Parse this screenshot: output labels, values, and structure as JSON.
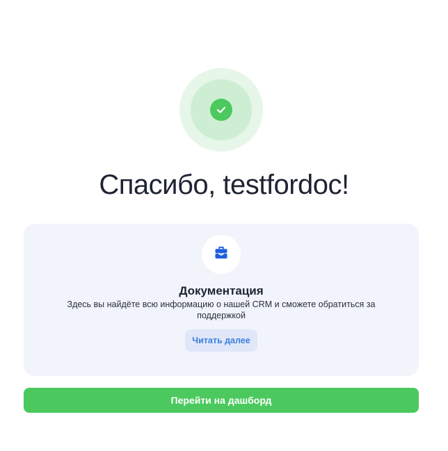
{
  "success": {
    "icon": "check-icon",
    "title": "Спасибо, testfordoc!"
  },
  "doc_card": {
    "icon": "briefcase-icon",
    "title": "Документация",
    "description": "Здесь вы найдёте всю информацию о нашей CRM и сможете обратиться за поддержкой",
    "read_more_label": "Читать далее"
  },
  "dashboard_button_label": "Перейти на дашборд",
  "colors": {
    "success_green": "#4bc95e",
    "link_blue": "#3f7fdc",
    "card_bg": "#f1f4fb",
    "icon_blue": "#1e5fe0"
  }
}
